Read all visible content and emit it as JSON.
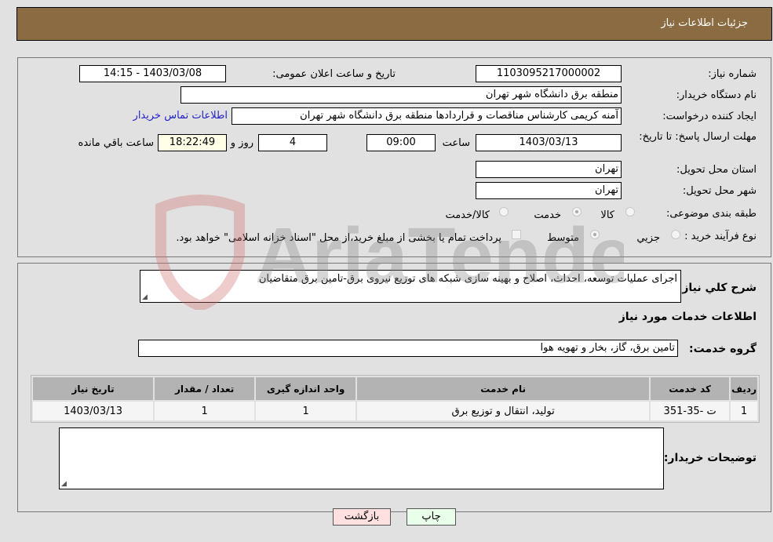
{
  "header": {
    "title": "جزئیات اطلاعات نیاز"
  },
  "details": {
    "need_number": {
      "label": "شماره نیاز:",
      "value": "1103095217000002"
    },
    "announce": {
      "label": "تاریخ و ساعت اعلان عمومی:",
      "value": "1403/03/08 - 14:15"
    },
    "buyer_org": {
      "label": "نام دستگاه خریدار:",
      "value": "منطقه برق دانشگاه شهر تهران"
    },
    "requester": {
      "label": "ایجاد کننده درخواست:",
      "value": "آمنه کریمی کارشناس مناقصات و قراردادها منطقه برق دانشگاه شهر تهران",
      "contact_link": "اطلاعات تماس خریدار"
    },
    "deadline": {
      "label": "مهلت ارسال پاسخ: تا تاریخ:",
      "date": "1403/03/13",
      "time_label": "ساعت",
      "time": "09:00",
      "days": "4",
      "days_label": "روز و",
      "remaining": "18:22:49",
      "remaining_label": "ساعت باقي مانده"
    },
    "province": {
      "label": "استان محل تحویل:",
      "value": "تهران"
    },
    "city": {
      "label": "شهر محل تحویل:",
      "value": "تهران"
    },
    "category": {
      "label": "طبقه بندی موضوعی:",
      "options": [
        {
          "label": "کالا",
          "selected": false
        },
        {
          "label": "خدمت",
          "selected": true
        },
        {
          "label": "کالا/خدمت",
          "selected": false
        }
      ]
    },
    "purchase_type": {
      "label": "نوع فرآیند خرید :",
      "options": [
        {
          "label": "جزیي",
          "selected": false
        },
        {
          "label": "متوسط",
          "selected": true
        }
      ],
      "treasury_note": "پرداخت تمام یا بخشی از مبلغ خرید،از محل \"اسناد خزانه اسلامی\" خواهد بود.",
      "treasury_checked": false
    }
  },
  "description": {
    "label": "شرح کلي نیاز:",
    "value": "اجرای عملیات توسعه، احداث، اصلاح و بهینه سازی شبکه های توزیع نیروی برق-تامین برق متقاضیان"
  },
  "services": {
    "section_title": "اطلاعات خدمات مورد نیاز",
    "group_label": "گروه خدمت:",
    "group_value": "تامین برق، گاز، بخار و تهویه هوا",
    "table": {
      "headers": [
        "ردیف",
        "کد خدمت",
        "نام خدمت",
        "واحد اندازه گیری",
        "تعداد / مقدار",
        "تاریخ نیاز"
      ],
      "rows": [
        [
          "1",
          "ت -35-351",
          "تولید، انتقال و توزیع برق",
          "1",
          "1",
          "1403/03/13"
        ]
      ]
    }
  },
  "buyer_notes": {
    "label": "توضیحات خریدار:",
    "value": ""
  },
  "buttons": {
    "print": "چاپ",
    "back": "بازگشت"
  },
  "watermark": {
    "text": "AriaTender.neT"
  },
  "colors": {
    "header_bg": "#8b6c42",
    "print_bg": "#eaffea",
    "back_bg": "#ffe0e0",
    "link": "#2222cc"
  }
}
